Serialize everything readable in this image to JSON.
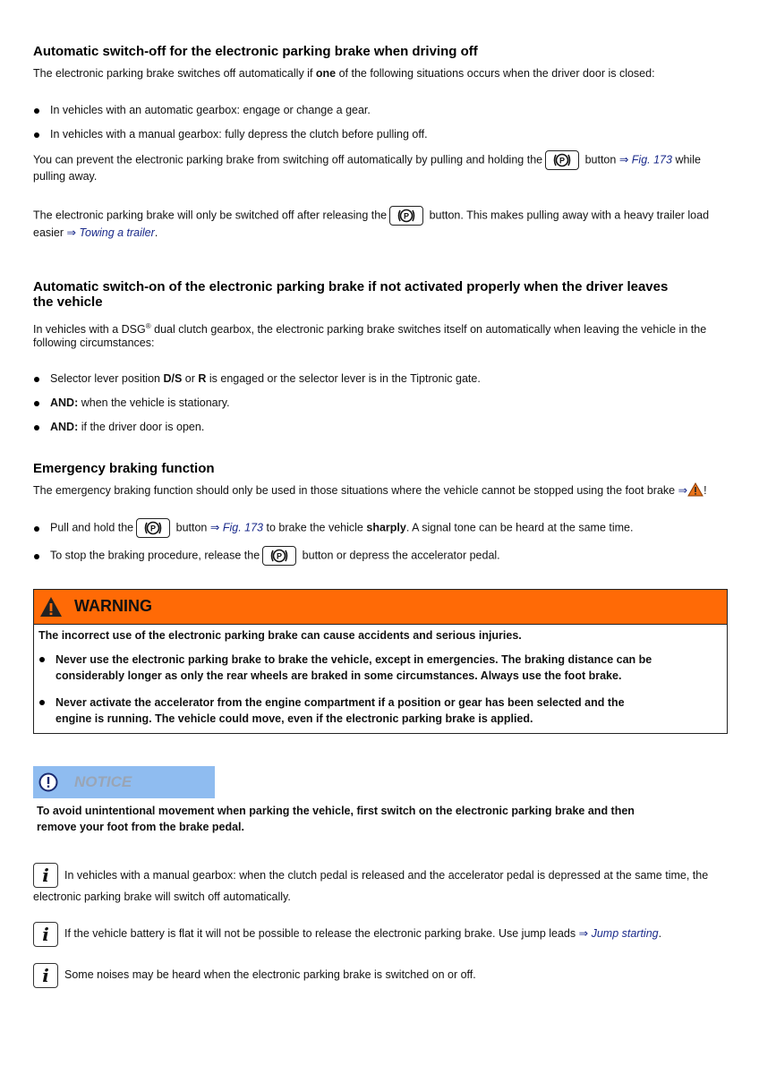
{
  "section1": {
    "heading": "Automatic switch-off for the electronic parking brake when driving off",
    "intro_before": "The electronic parking brake switches off automatically if ",
    "intro_bold": "one",
    "intro_after": " of the following situations occurs when the driver door is closed:",
    "bullets": [
      "In vehicles with an automatic gearbox: engage or change a gear.",
      "In vehicles with a manual gearbox: fully depress the clutch before pulling off."
    ],
    "para2_before": "You can prevent the electronic parking brake from switching off automatically by pulling and holding the",
    "para2_after": "button",
    "para2_link": "Fig. 173",
    "para2_end": "while",
    "para2_line2": "pulling away.",
    "para3_before": "The electronic parking brake will only be switched off after releasing the",
    "para3_after": "button. This makes pulling away with a heavy trailer load",
    "para3_line2_before": "easier",
    "para3_link": "Towing a trailer",
    "para3_end": "."
  },
  "section2": {
    "heading_line1": "Automatic switch-on of the electronic parking brake if not activated properly when the driver leaves",
    "heading_line2": "the vehicle",
    "intro_line1_a": "In vehicles with a DSG",
    "intro_sup": "®",
    "intro_line1_b": " dual clutch gearbox, the electronic parking brake switches itself on automatically when leaving the vehicle in the",
    "intro_line2": "following circumstances:",
    "bullets": [
      {
        "a": "Selector lever position ",
        "b1": "D/S",
        "c": " or ",
        "b2": "R",
        "d": " is engaged or the selector lever is in the Tiptronic gate."
      },
      {
        "bold": "AND:",
        "text": " when the vehicle is stationary."
      },
      {
        "bold": "AND:",
        "text": " if the driver door is open."
      }
    ]
  },
  "section3": {
    "heading": "Emergency braking function",
    "intro": "The emergency braking function should only be used in those situations where the vehicle cannot be stopped using the foot brake",
    "intro_end": "!",
    "bullet1_a": "Pull and hold the",
    "bullet1_b": "button",
    "bullet1_link": "Fig. 173",
    "bullet1_c": " to brake the vehicle ",
    "bullet1_bold": "sharply",
    "bullet1_d": ". A signal tone can be heard at the same time.",
    "bullet2_a": "To stop the braking procedure, release the",
    "bullet2_b": "button or depress the accelerator pedal."
  },
  "warning": {
    "title": "WARNING",
    "color": "#ff6a06",
    "lead": "The incorrect use of the electronic parking brake can cause accidents and serious injuries.",
    "bullets": [
      [
        "Never use the electronic parking brake to brake the vehicle, except in emergencies. The braking distance can be",
        "considerably longer as only the rear wheels are braked in some circumstances. Always use the foot brake."
      ],
      [
        "Never activate the accelerator from the engine compartment if a position or gear has been selected and the",
        "engine is running. The vehicle could move, even if the electronic parking brake is applied."
      ]
    ]
  },
  "notice": {
    "title": "NOTICE",
    "color": "#8fbcf0",
    "line1": "To avoid unintentional movement when parking the vehicle, first switch on the electronic parking brake and then",
    "line2": "remove your foot from the brake pedal."
  },
  "info": [
    {
      "line1": "In vehicles with a manual gearbox: when the clutch pedal is released and the accelerator pedal is depressed at the same time, the",
      "line2": "electronic parking brake will switch off automatically."
    },
    {
      "text": "If the vehicle battery is flat it will not be possible to release the electronic parking brake. Use jump leads",
      "link": "Jump starting",
      "end": "."
    },
    {
      "text": "Some noises may be heard when the electronic parking brake is switched on or off."
    }
  ],
  "symbols": {
    "arrow": "⇒",
    "info_glyph": "i",
    "button_icon": "parking-brake-icon"
  }
}
